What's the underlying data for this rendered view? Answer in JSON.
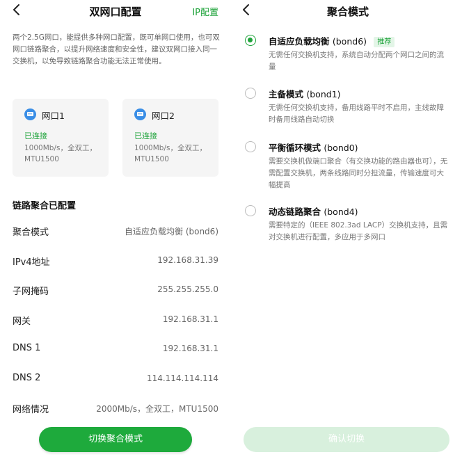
{
  "left": {
    "title": "双网口配置",
    "ip_link": "IP配置",
    "description": "两个2.5G网口，能提供多种网口配置，既可单网口使用，也可双网口链路聚合，以提升网络速度和安全性，建议双网口接入同一交换机，以免导致链路聚合功能无法正常使用。",
    "ports": [
      {
        "name": "网口1",
        "status": "已连接",
        "detail": "1000Mb/s，全双工，MTU1500",
        "icon": "ethernet-port-icon"
      },
      {
        "name": "网口2",
        "status": "已连接",
        "detail": "1000Mb/s，全双工，MTU1500",
        "icon": "ethernet-port-icon"
      }
    ],
    "section_title": "链路聚合已配置",
    "info": [
      {
        "label": "聚合模式",
        "value": "自适应负载均衡 (bond6)"
      },
      {
        "label": "IPv4地址",
        "value": "192.168.31.39"
      },
      {
        "label": "子网掩码",
        "value": "255.255.255.0"
      },
      {
        "label": "网关",
        "value": "192.168.31.1"
      },
      {
        "label": "DNS 1",
        "value": "192.168.31.1"
      },
      {
        "label": "DNS 2",
        "value": "114.114.114.114"
      },
      {
        "label": "网络情况",
        "value": "2000Mb/s，全双工，MTU1500"
      }
    ],
    "button": "切换聚合模式"
  },
  "right": {
    "title": "聚合模式",
    "options": [
      {
        "title": "自适应负载均衡",
        "code": "(bond6)",
        "badge": "推荐",
        "desc": "无需任何交换机支持，系统自动分配两个网口之间的流量",
        "selected": true
      },
      {
        "title": "主备模式",
        "code": "(bond1)",
        "desc": "无需任何交换机支持，备用线路平时不启用，主线故障时备用线路自动切换",
        "selected": false
      },
      {
        "title": "平衡循环模式",
        "code": "(bond0)",
        "desc": "需要交换机做端口聚合（有交换功能的路由器也可），无需配置交换机，两条线路同时分担流量，传输速度可大幅提高",
        "selected": false
      },
      {
        "title": "动态链路聚合",
        "code": "(bond4)",
        "desc": "需要特定的（IEEE 802.3ad LACP）交换机支持，且需对交换机进行配置，多应用于多网口",
        "selected": false
      }
    ],
    "button": "确认切换"
  },
  "colors": {
    "accent": "#1ea33a",
    "button": "#1eaa3c",
    "button_disabled": "#d8f0dd"
  }
}
